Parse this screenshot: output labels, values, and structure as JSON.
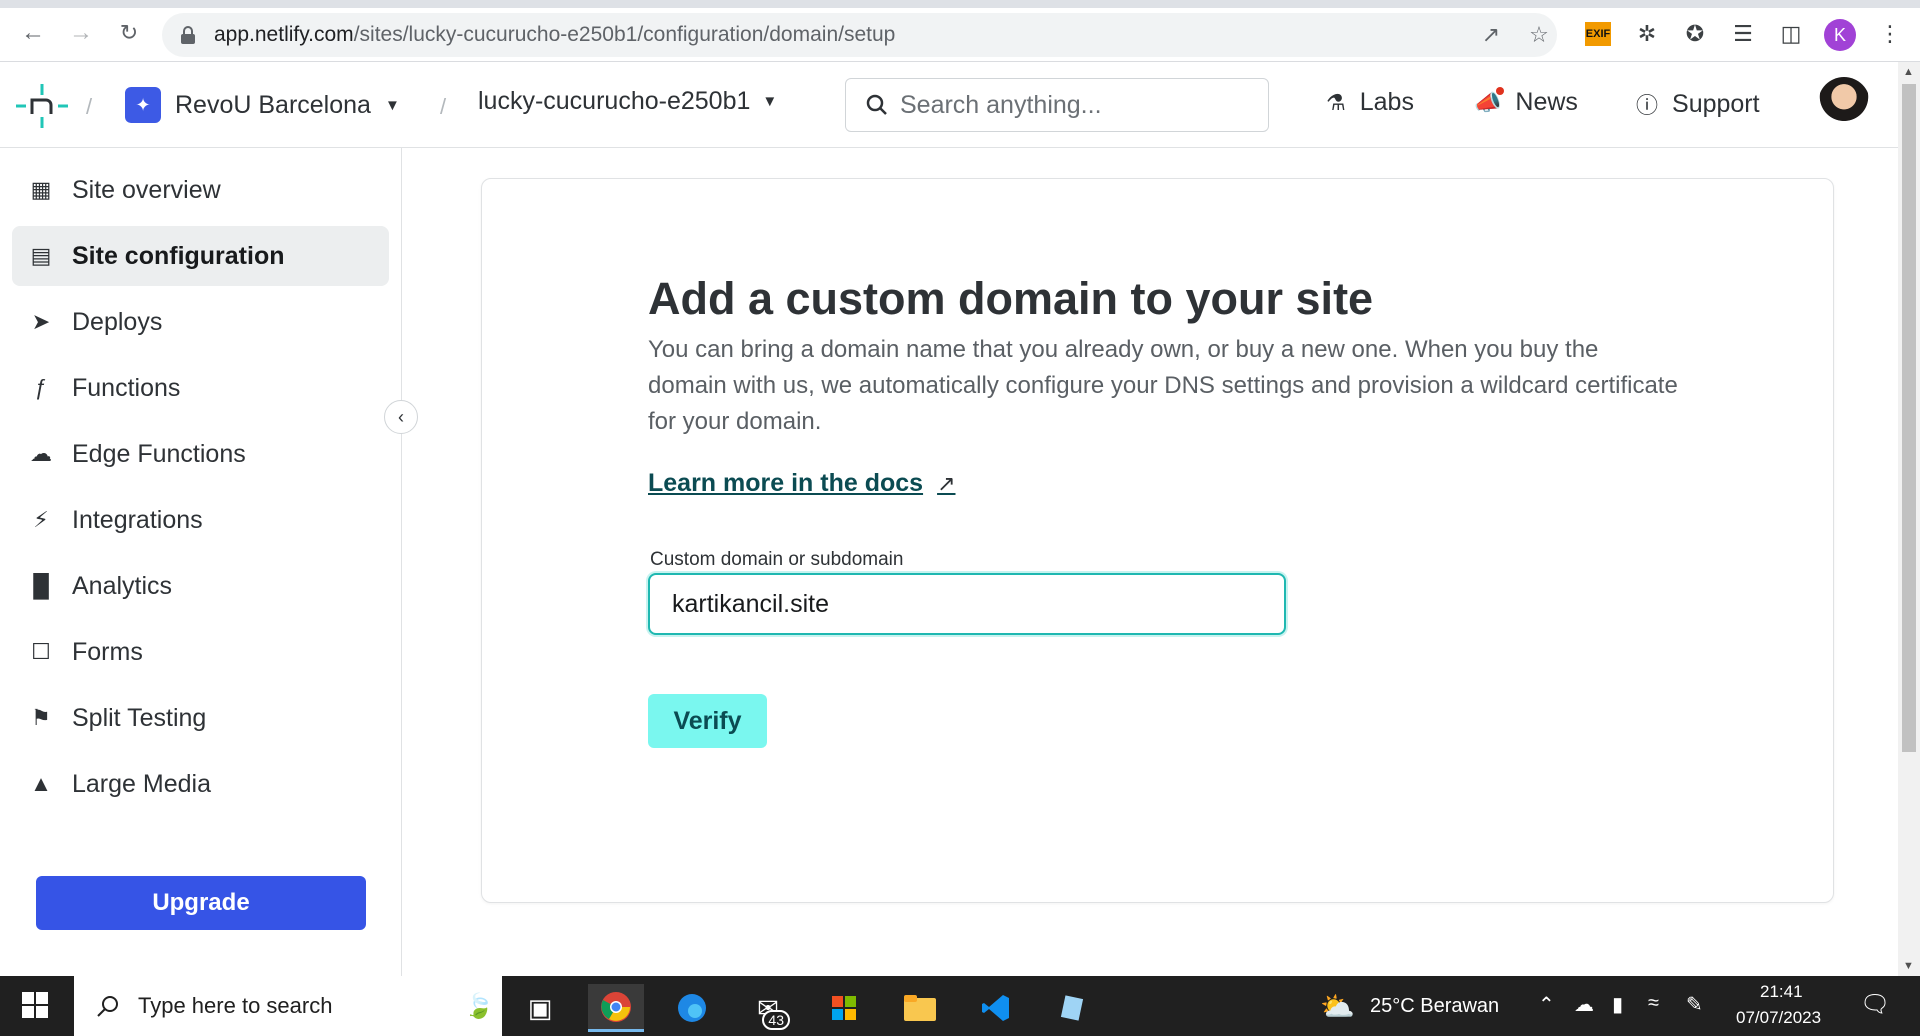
{
  "browser": {
    "url_host": "app.netlify.com",
    "url_path": "/sites/lucky-cucurucho-e250b1/configuration/domain/setup",
    "profile_initial": "K",
    "ext_exif_label": "EXIF"
  },
  "header": {
    "team_name": "RevoU Barcelona",
    "site_name": "lucky-cucurucho-e250b1",
    "search_placeholder": "Search anything...",
    "links": [
      "Labs",
      "News",
      "Support"
    ]
  },
  "sidebar": {
    "items": [
      {
        "label": "Site overview",
        "icon": "grid-icon"
      },
      {
        "label": "Site configuration",
        "icon": "server-icon",
        "active": true
      },
      {
        "label": "Deploys",
        "icon": "rocket-icon"
      },
      {
        "label": "Functions",
        "icon": "function-icon"
      },
      {
        "label": "Edge Functions",
        "icon": "edge-icon"
      },
      {
        "label": "Integrations",
        "icon": "plug-icon"
      },
      {
        "label": "Analytics",
        "icon": "bar-chart-icon"
      },
      {
        "label": "Forms",
        "icon": "form-icon"
      },
      {
        "label": "Split Testing",
        "icon": "signpost-icon"
      },
      {
        "label": "Large Media",
        "icon": "media-icon"
      }
    ],
    "upgrade_label": "Upgrade"
  },
  "main": {
    "title": "Add a custom domain to your site",
    "description": "You can bring a domain name that you already own, or buy a new one. When you buy the domain with us, we automatically configure your DNS settings and provision a wildcard certificate for your domain.",
    "docs_link": "Learn more in the docs",
    "docs_arrow": "↗",
    "field_label": "Custom domain or subdomain",
    "field_value": "kartikancil.site",
    "verify_label": "Verify"
  },
  "taskbar": {
    "search_placeholder": "Type here to search",
    "mail_badge": "43",
    "weather": "25°C  Berawan",
    "time": "21:41",
    "date": "07/07/2023"
  },
  "colors": {
    "accent_teal": "#7af7ef",
    "upgrade_blue": "#3654e6",
    "link_dark_teal": "#0b4b52"
  }
}
